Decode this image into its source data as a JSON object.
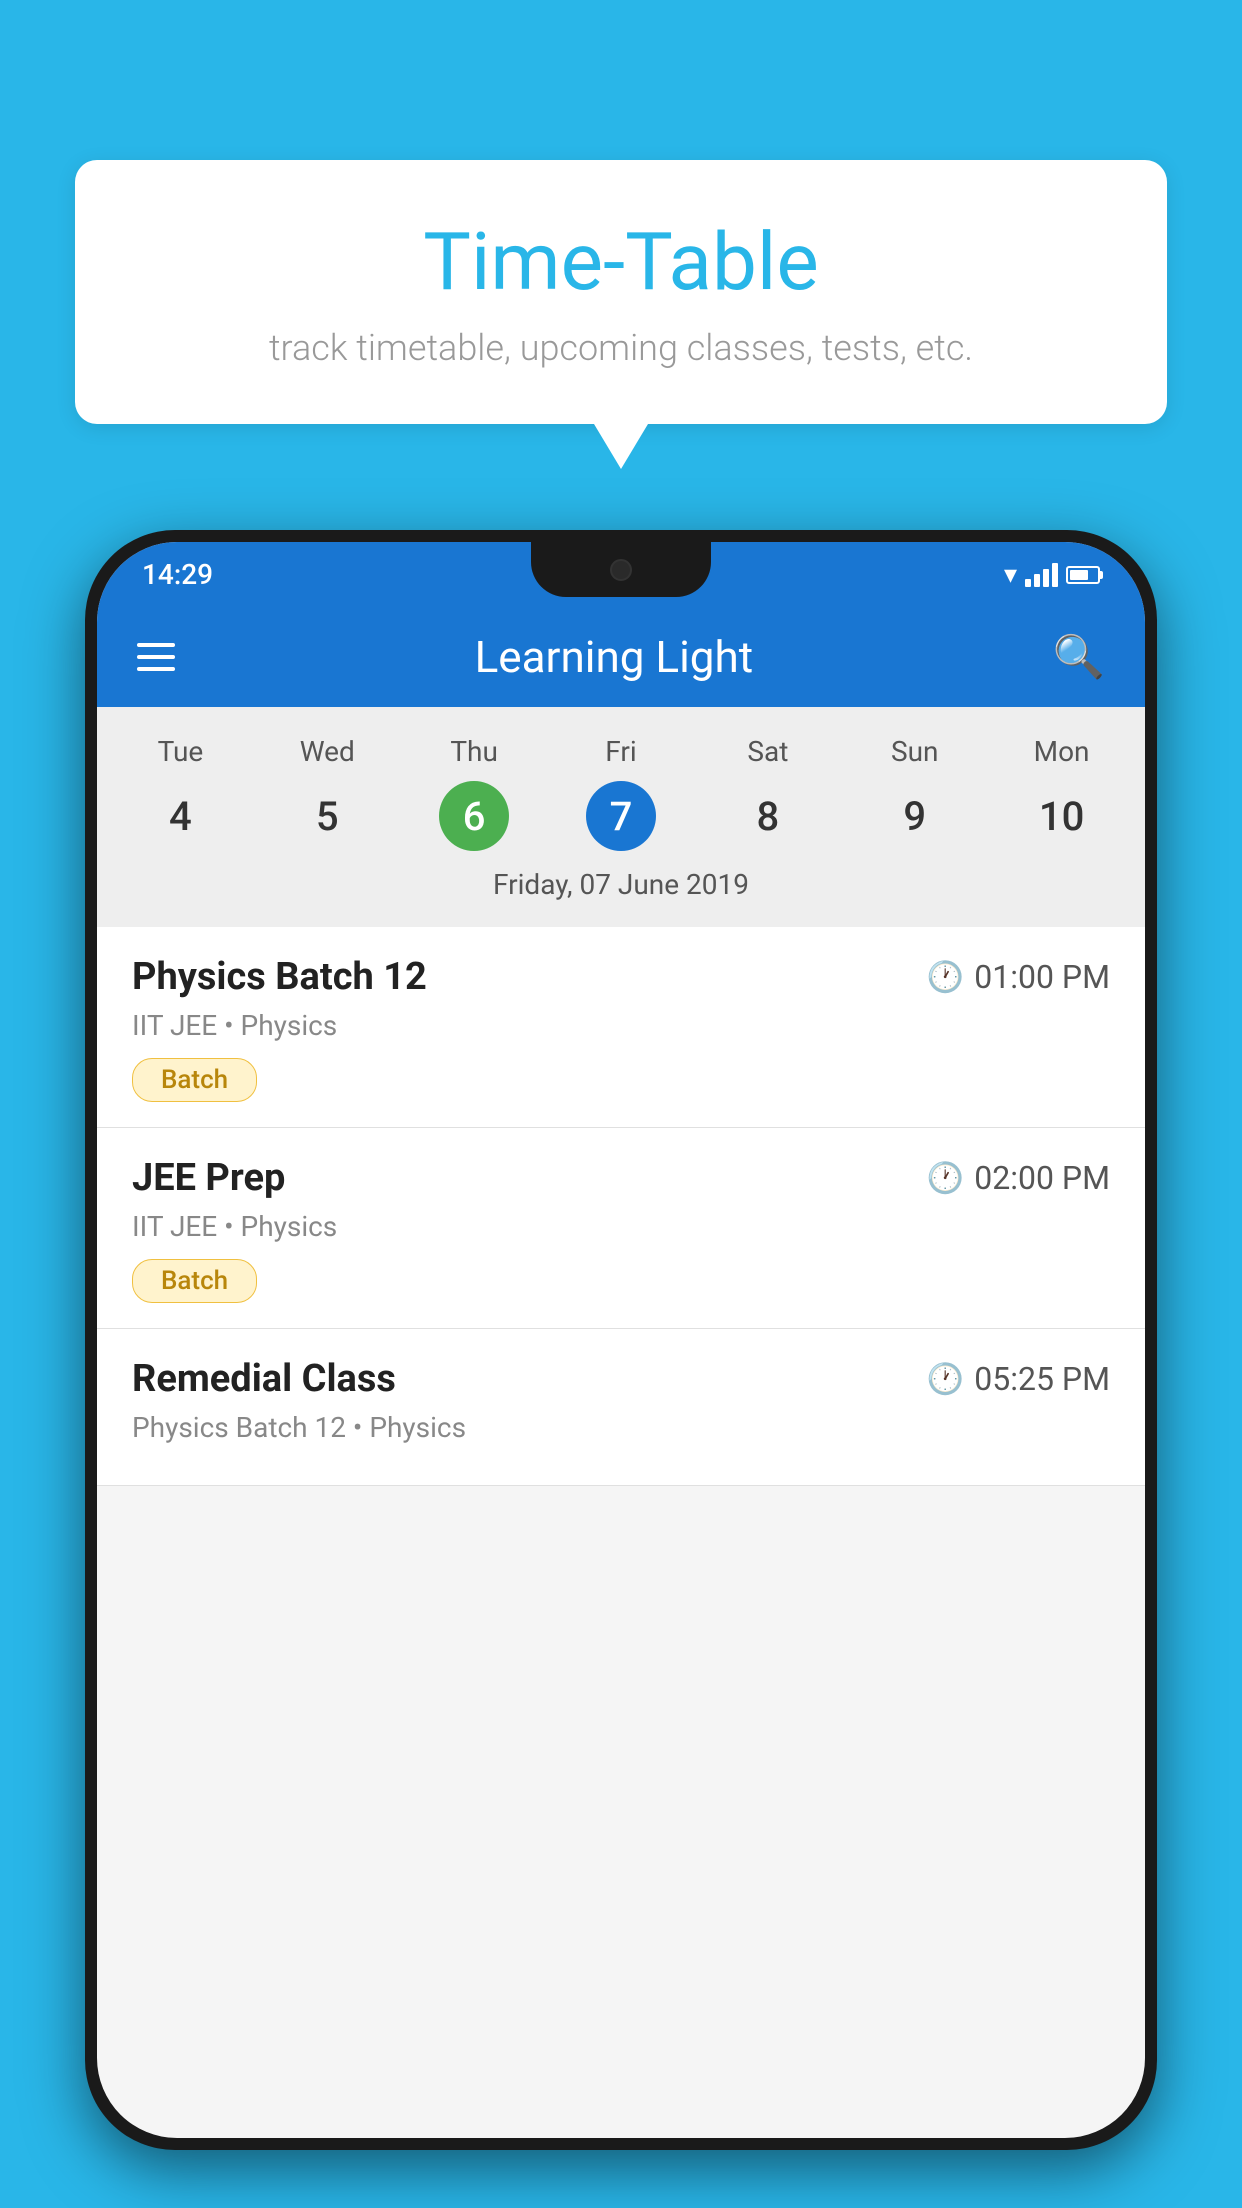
{
  "background_color": "#29b6e8",
  "bubble": {
    "title": "Time-Table",
    "subtitle": "track timetable, upcoming classes, tests, etc."
  },
  "status_bar": {
    "time": "14:29"
  },
  "app_bar": {
    "title": "Learning Light"
  },
  "calendar": {
    "days": [
      "Tue",
      "Wed",
      "Thu",
      "Fri",
      "Sat",
      "Sun",
      "Mon"
    ],
    "dates": [
      "4",
      "5",
      "6",
      "7",
      "8",
      "9",
      "10"
    ],
    "today_index": 2,
    "selected_index": 3,
    "selected_date_label": "Friday, 07 June 2019"
  },
  "schedule": [
    {
      "title": "Physics Batch 12",
      "time": "01:00 PM",
      "subtitle": "IIT JEE • Physics",
      "badge": "Batch"
    },
    {
      "title": "JEE Prep",
      "time": "02:00 PM",
      "subtitle": "IIT JEE • Physics",
      "badge": "Batch"
    },
    {
      "title": "Remedial Class",
      "time": "05:25 PM",
      "subtitle": "Physics Batch 12 • Physics",
      "badge": ""
    }
  ]
}
